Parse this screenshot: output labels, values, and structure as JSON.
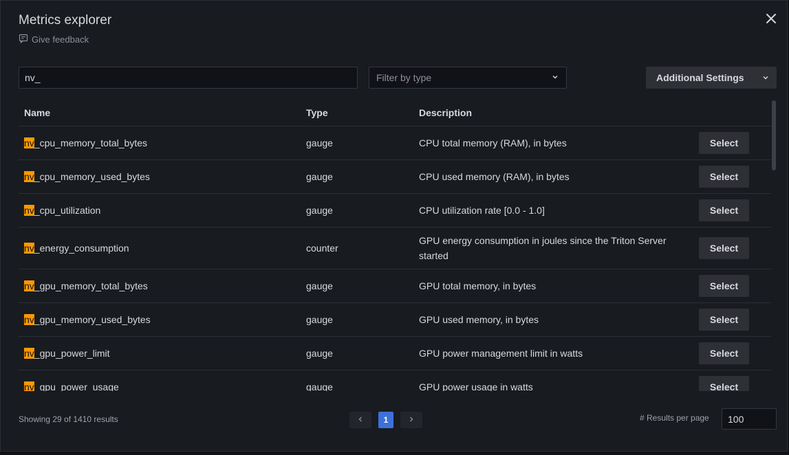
{
  "header": {
    "title": "Metrics explorer",
    "feedback_label": "Give feedback"
  },
  "controls": {
    "search_value": "nv_",
    "filter_placeholder": "Filter by type",
    "additional_settings_label": "Additional Settings"
  },
  "table": {
    "columns": {
      "name": "Name",
      "type": "Type",
      "description": "Description"
    },
    "highlight": "nv",
    "select_label": "Select",
    "rows": [
      {
        "prefix": "nv",
        "rest": "_cpu_memory_total_bytes",
        "type": "gauge",
        "description": "CPU total memory (RAM), in bytes"
      },
      {
        "prefix": "nv",
        "rest": "_cpu_memory_used_bytes",
        "type": "gauge",
        "description": "CPU used memory (RAM), in bytes"
      },
      {
        "prefix": "nv",
        "rest": "_cpu_utilization",
        "type": "gauge",
        "description": "CPU utilization rate [0.0 - 1.0]"
      },
      {
        "prefix": "nv",
        "rest": "_energy_consumption",
        "type": "counter",
        "description": "GPU energy consumption in joules since the Triton Server started"
      },
      {
        "prefix": "nv",
        "rest": "_gpu_memory_total_bytes",
        "type": "gauge",
        "description": "GPU total memory, in bytes"
      },
      {
        "prefix": "nv",
        "rest": "_gpu_memory_used_bytes",
        "type": "gauge",
        "description": "GPU used memory, in bytes"
      },
      {
        "prefix": "nv",
        "rest": "_gpu_power_limit",
        "type": "gauge",
        "description": "GPU power management limit in watts"
      },
      {
        "prefix": "nv",
        "rest": "_gpu_power_usage",
        "type": "gauge",
        "description": "GPU power usage in watts"
      }
    ]
  },
  "footer": {
    "showing_text": "Showing 29 of 1410 results",
    "current_page": "1",
    "results_per_page_label": "# Results per page",
    "results_per_page_value": "100"
  },
  "icons": {
    "close": "close-icon",
    "feedback": "comment-icon",
    "chevron": "chevron-down-icon",
    "prev": "chevron-left-icon",
    "next": "chevron-right-icon"
  },
  "colors": {
    "highlight": "#ff9900",
    "accent": "#3d71d9",
    "background": "#181b1f"
  }
}
